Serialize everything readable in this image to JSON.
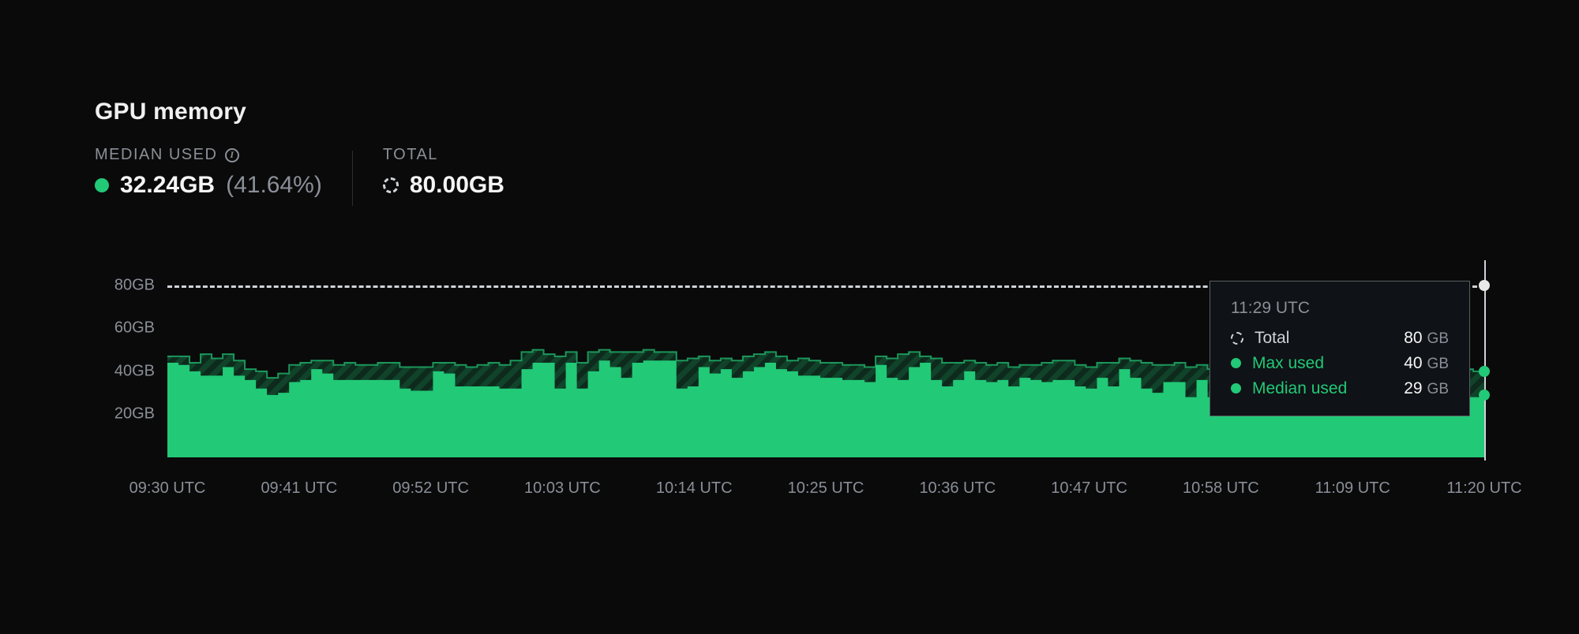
{
  "title": "GPU memory",
  "stats": {
    "median_used": {
      "label": "MEDIAN USED",
      "value": "32.24GB",
      "percent": "(41.64%)"
    },
    "total": {
      "label": "TOTAL",
      "value": "80.00GB"
    }
  },
  "tooltip": {
    "time": "11:29 UTC",
    "rows": {
      "total": {
        "label": "Total",
        "value": "80",
        "unit": "GB"
      },
      "max_used": {
        "label": "Max used",
        "value": "40",
        "unit": "GB"
      },
      "median_used": {
        "label": "Median used",
        "value": "29",
        "unit": "GB"
      }
    }
  },
  "colors": {
    "green": "#22c977",
    "stripe_dark": "#1e4a35",
    "bg": "#0a0a0a",
    "grid": "#2a2e34",
    "muted": "#8a8f98"
  },
  "chart_data": {
    "type": "area",
    "title": "GPU memory",
    "ylabel": "GB",
    "ylim": [
      0,
      88
    ],
    "y_ticks": [
      "20GB",
      "40GB",
      "60GB",
      "80GB"
    ],
    "limit_line": 80,
    "x_tick_labels": [
      "09:30 UTC",
      "09:41 UTC",
      "09:52 UTC",
      "10:03 UTC",
      "10:14 UTC",
      "10:25 UTC",
      "10:36 UTC",
      "10:47 UTC",
      "10:58 UTC",
      "11:09 UTC",
      "11:20 UTC"
    ],
    "x": [
      "09:30",
      "09:31",
      "09:32",
      "09:33",
      "09:34",
      "09:35",
      "09:36",
      "09:37",
      "09:38",
      "09:39",
      "09:40",
      "09:41",
      "09:42",
      "09:43",
      "09:44",
      "09:45",
      "09:46",
      "09:47",
      "09:48",
      "09:49",
      "09:50",
      "09:51",
      "09:52",
      "09:53",
      "09:54",
      "09:55",
      "09:56",
      "09:57",
      "09:58",
      "09:59",
      "10:00",
      "10:01",
      "10:02",
      "10:03",
      "10:04",
      "10:05",
      "10:06",
      "10:07",
      "10:08",
      "10:09",
      "10:10",
      "10:11",
      "10:12",
      "10:13",
      "10:14",
      "10:15",
      "10:16",
      "10:17",
      "10:18",
      "10:19",
      "10:20",
      "10:21",
      "10:22",
      "10:23",
      "10:24",
      "10:25",
      "10:26",
      "10:27",
      "10:28",
      "10:29",
      "10:30",
      "10:31",
      "10:32",
      "10:33",
      "10:34",
      "10:35",
      "10:36",
      "10:37",
      "10:38",
      "10:39",
      "10:40",
      "10:41",
      "10:42",
      "10:43",
      "10:44",
      "10:45",
      "10:46",
      "10:47",
      "10:48",
      "10:49",
      "10:50",
      "10:51",
      "10:52",
      "10:53",
      "10:54",
      "10:55",
      "10:56",
      "10:57",
      "10:58",
      "10:59",
      "11:00",
      "11:01",
      "11:02",
      "11:03",
      "11:04",
      "11:05",
      "11:06",
      "11:07",
      "11:08",
      "11:09",
      "11:10",
      "11:11",
      "11:12",
      "11:13",
      "11:14",
      "11:15",
      "11:16",
      "11:17",
      "11:18",
      "11:19",
      "11:20",
      "11:21",
      "11:22",
      "11:23",
      "11:24",
      "11:25",
      "11:26",
      "11:27",
      "11:28",
      "11:29"
    ],
    "series": [
      {
        "name": "Max used",
        "color": "striped",
        "values": [
          47,
          47,
          44,
          48,
          46,
          48,
          45,
          41,
          40,
          37,
          39,
          43,
          44,
          45,
          45,
          43,
          44,
          43,
          43,
          44,
          44,
          42,
          42,
          42,
          44,
          44,
          43,
          42,
          43,
          44,
          43,
          45,
          49,
          50,
          48,
          47,
          49,
          44,
          49,
          50,
          49,
          49,
          49,
          50,
          49,
          49,
          45,
          46,
          47,
          45,
          46,
          45,
          47,
          48,
          49,
          47,
          45,
          46,
          45,
          44,
          44,
          43,
          43,
          42,
          47,
          46,
          48,
          49,
          47,
          46,
          44,
          44,
          45,
          44,
          43,
          44,
          42,
          43,
          43,
          44,
          45,
          45,
          43,
          42,
          44,
          44,
          46,
          45,
          44,
          43,
          43,
          44,
          42,
          43,
          41,
          41,
          44,
          43,
          43,
          43,
          43,
          41,
          42,
          42,
          41,
          41,
          42,
          42,
          43,
          43,
          43,
          43,
          41,
          42,
          41,
          41,
          42,
          41,
          40,
          40
        ]
      },
      {
        "name": "Median used",
        "color": "#22c977",
        "values": [
          44,
          43,
          40,
          38,
          38,
          42,
          38,
          36,
          32,
          29,
          30,
          35,
          36,
          41,
          39,
          36,
          36,
          36,
          36,
          36,
          36,
          32,
          31,
          31,
          40,
          39,
          33,
          33,
          33,
          33,
          32,
          32,
          41,
          44,
          44,
          32,
          44,
          32,
          40,
          45,
          42,
          37,
          44,
          45,
          45,
          45,
          32,
          33,
          42,
          39,
          41,
          37,
          40,
          42,
          44,
          41,
          40,
          38,
          38,
          37,
          37,
          36,
          36,
          35,
          43,
          37,
          36,
          42,
          44,
          36,
          33,
          36,
          40,
          36,
          35,
          36,
          33,
          37,
          36,
          35,
          36,
          36,
          33,
          32,
          37,
          33,
          41,
          37,
          32,
          30,
          35,
          35,
          28,
          36,
          28,
          28,
          37,
          36,
          35,
          34,
          35,
          29,
          34,
          35,
          28,
          28,
          30,
          31,
          36,
          36,
          36,
          35,
          29,
          32,
          28,
          28,
          31,
          28,
          28,
          29
        ]
      }
    ],
    "cursor": {
      "x_index": 119,
      "total": 80,
      "max_used": 40,
      "median_used": 29
    }
  }
}
